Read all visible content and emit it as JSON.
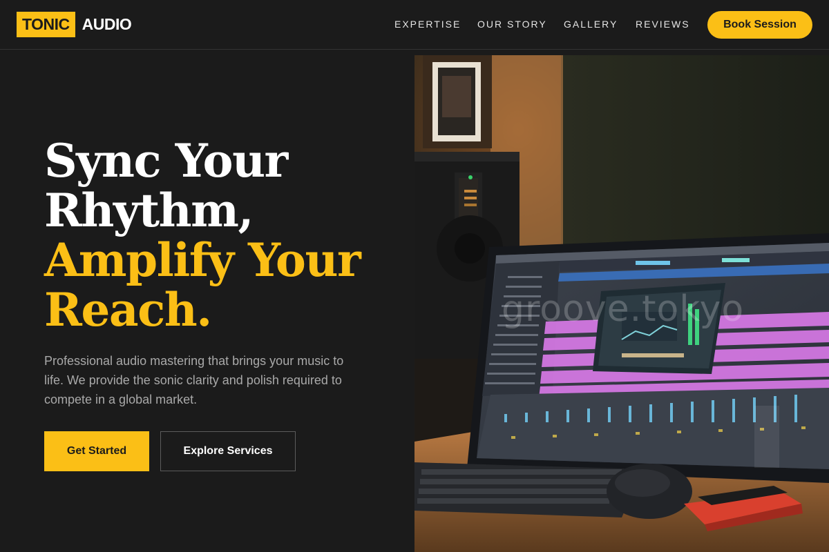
{
  "brand": {
    "box_text": "TONIC",
    "text": "AUDIO"
  },
  "nav": {
    "items": [
      {
        "label": "EXPERTISE"
      },
      {
        "label": "OUR STORY"
      },
      {
        "label": "GALLERY"
      },
      {
        "label": "REVIEWS"
      }
    ],
    "cta_label": "Book Session"
  },
  "hero": {
    "headline_line1": "Sync Your",
    "headline_line2": "Rhythm,",
    "headline_line3": "Amplify Your",
    "headline_line4": "Reach.",
    "subtitle": "Professional audio mastering that brings your music to life. We provide the sonic clarity and polish required to compete in a global market.",
    "primary_button": "Get Started",
    "secondary_button": "Explore Services",
    "image_watermark": "groove.tokyo"
  },
  "colors": {
    "accent": "#fbbf16",
    "background": "#1b1b1b",
    "muted_text": "#a9a9a9",
    "daw_clip_pink": "#d779e6"
  },
  "icons": {
    "hero_image": "studio-monitor-daw-photo"
  }
}
